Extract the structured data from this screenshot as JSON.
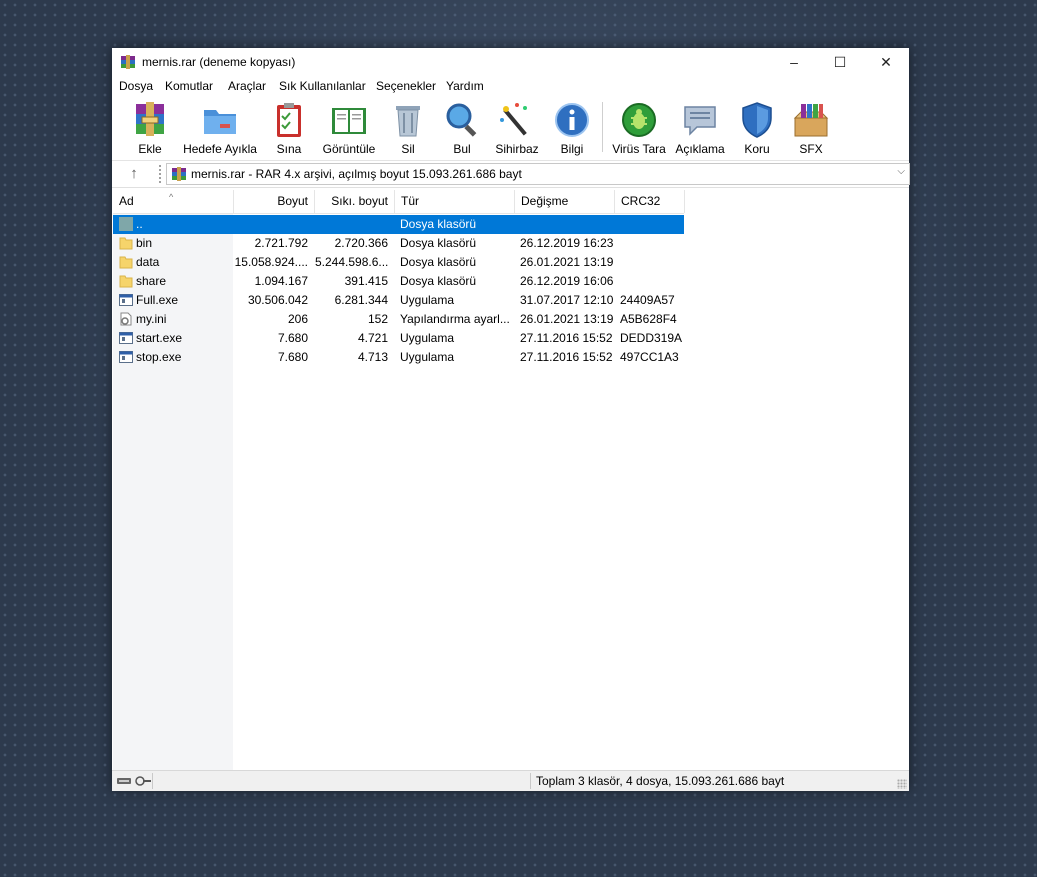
{
  "window": {
    "title": "mernis.rar (deneme kopyası)"
  },
  "window_controls": {
    "minimize": "–",
    "maximize": "☐",
    "close": "✕"
  },
  "menu": [
    "Dosya",
    "Komutlar",
    "Araçlar",
    "Sık Kullanılanlar",
    "Seçenekler",
    "Yardım"
  ],
  "toolbar": [
    {
      "label": "Ekle",
      "icon": "add-archive-icon"
    },
    {
      "label": "Hedefe Ayıkla",
      "icon": "extract-folder-icon"
    },
    {
      "label": "Sına",
      "icon": "test-clipboard-icon"
    },
    {
      "label": "Görüntüle",
      "icon": "view-book-icon"
    },
    {
      "label": "Sil",
      "icon": "trash-icon"
    },
    {
      "label": "Bul",
      "icon": "search-magnifier-icon"
    },
    {
      "label": "Sihirbaz",
      "icon": "wizard-wand-icon"
    },
    {
      "label": "Bilgi",
      "icon": "info-icon"
    },
    {
      "label": "Virüs Tara",
      "icon": "virus-scan-icon"
    },
    {
      "label": "Açıklama",
      "icon": "comment-icon"
    },
    {
      "label": "Koru",
      "icon": "shield-icon"
    },
    {
      "label": "SFX",
      "icon": "sfx-box-icon"
    }
  ],
  "address": {
    "up": "↑",
    "text": "mernis.rar - RAR 4.x arşivi, açılmış boyut 15.093.261.686 bayt",
    "chevron": "⌵"
  },
  "columns": {
    "name": "Ad",
    "size": "Boyut",
    "packed": "Sıkı. boyut",
    "type": "Tür",
    "modified": "Değişme",
    "crc": "CRC32",
    "sort_indicator": "^"
  },
  "rows": [
    {
      "name": "..",
      "size": "",
      "packed": "",
      "type": "Dosya klasörü",
      "modified": "",
      "crc": "",
      "kind": "parent",
      "selected": true
    },
    {
      "name": "bin",
      "size": "2.721.792",
      "packed": "2.720.366",
      "type": "Dosya klasörü",
      "modified": "26.12.2019 16:23",
      "crc": "",
      "kind": "folder"
    },
    {
      "name": "data",
      "size": "15.058.924....",
      "packed": "5.244.598.6...",
      "type": "Dosya klasörü",
      "modified": "26.01.2021 13:19",
      "crc": "",
      "kind": "folder"
    },
    {
      "name": "share",
      "size": "1.094.167",
      "packed": "391.415",
      "type": "Dosya klasörü",
      "modified": "26.12.2019 16:06",
      "crc": "",
      "kind": "folder"
    },
    {
      "name": "Full.exe",
      "size": "30.506.042",
      "packed": "6.281.344",
      "type": "Uygulama",
      "modified": "31.07.2017 12:10",
      "crc": "24409A57",
      "kind": "exe"
    },
    {
      "name": "my.ini",
      "size": "206",
      "packed": "152",
      "type": "Yapılandırma ayarl...",
      "modified": "26.01.2021 13:19",
      "crc": "A5B628F4",
      "kind": "ini"
    },
    {
      "name": "start.exe",
      "size": "7.680",
      "packed": "4.721",
      "type": "Uygulama",
      "modified": "27.11.2016 15:52",
      "crc": "DEDD319A",
      "kind": "exe"
    },
    {
      "name": "stop.exe",
      "size": "7.680",
      "packed": "4.713",
      "type": "Uygulama",
      "modified": "27.11.2016 15:52",
      "crc": "497CC1A3",
      "kind": "exe"
    }
  ],
  "status": {
    "text": "Toplam 3 klasör, 4 dosya, 15.093.261.686 bayt"
  },
  "colors": {
    "selection": "#0078d7",
    "folder": "#f6d46b"
  }
}
